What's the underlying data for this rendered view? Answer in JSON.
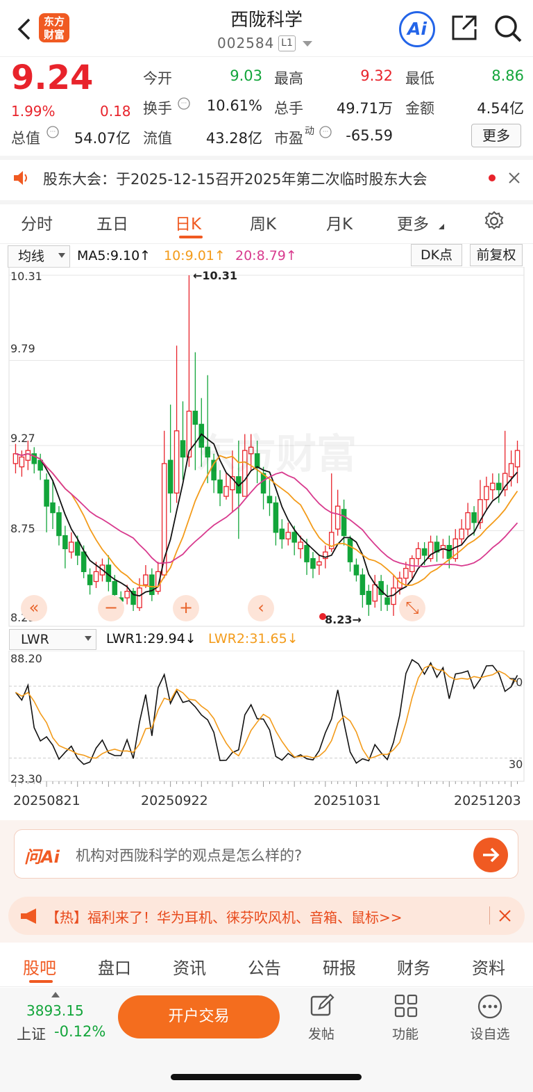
{
  "header": {
    "logo_text": "东方财富",
    "title": "西陇科学",
    "code": "002584",
    "level": "L1",
    "ai_label": "Ai"
  },
  "quote": {
    "price": "9.24",
    "change_pct": "1.99%",
    "change": "0.18",
    "open_label": "今开",
    "open": "9.03",
    "high_label": "最高",
    "high": "9.32",
    "low_label": "最低",
    "low": "8.86",
    "turnover_label": "换手",
    "turnover": "10.61%",
    "volume_label": "总手",
    "volume": "49.71万",
    "amount_label": "金额",
    "amount": "4.54亿",
    "mktcap_label": "总值",
    "mktcap": "54.07亿",
    "float_label": "流值",
    "float": "43.28亿",
    "pe_label": "市盈",
    "pe_sup": "动",
    "pe": "-65.59",
    "more_label": "更多"
  },
  "notice": {
    "text": "股东大会：于2025-12-15召开2025年第二次临时股东大会"
  },
  "tabs": [
    "分时",
    "五日",
    "日K",
    "周K",
    "月K",
    "更多"
  ],
  "active_tab": "日K",
  "chart_toolbar": {
    "indicator": "均线",
    "ma5": "MA5:9.10↑",
    "ma10": "10:9.01↑",
    "ma20": "20:8.79↑",
    "dk": "DK点",
    "adjust": "前复权"
  },
  "colors": {
    "up": "#e8232b",
    "down": "#12a53a",
    "ma5": "#111111",
    "ma10": "#f39b1a",
    "ma20": "#d83a8e",
    "accent": "#f05a22"
  },
  "chart_data": [
    {
      "type": "candlestick",
      "y_ticks": [
        "10.31",
        "9.79",
        "9.27",
        "8.75",
        "8.23"
      ],
      "ylim": [
        8.23,
        10.31
      ],
      "max_annotation": "←10.31",
      "min_annotation": "8.23→",
      "watermark": "东方财富",
      "candles": [
        [
          9.16,
          9.22,
          9.1,
          9.28
        ],
        [
          9.14,
          9.2,
          9.08,
          9.24
        ],
        [
          9.18,
          9.24,
          9.12,
          9.3
        ],
        [
          9.22,
          9.16,
          9.1,
          9.26
        ],
        [
          9.18,
          9.12,
          9.06,
          9.22
        ],
        [
          9.06,
          8.9,
          8.74,
          9.1
        ],
        [
          8.92,
          8.86,
          8.76,
          9.06
        ],
        [
          8.86,
          8.72,
          8.66,
          8.9
        ],
        [
          8.72,
          8.64,
          8.52,
          8.78
        ],
        [
          8.62,
          8.68,
          8.58,
          8.74
        ],
        [
          8.68,
          8.6,
          8.54,
          8.72
        ],
        [
          8.62,
          8.5,
          8.46,
          8.66
        ],
        [
          8.48,
          8.42,
          8.36,
          8.52
        ],
        [
          8.44,
          8.5,
          8.4,
          8.56
        ],
        [
          8.48,
          8.54,
          8.44,
          8.58
        ],
        [
          8.54,
          8.44,
          8.38,
          8.6
        ],
        [
          8.44,
          8.36,
          8.3,
          8.48
        ],
        [
          8.34,
          8.32,
          8.26,
          8.38
        ],
        [
          8.34,
          8.38,
          8.3,
          8.42
        ],
        [
          8.38,
          8.3,
          8.26,
          8.4
        ],
        [
          8.28,
          8.4,
          8.26,
          8.46
        ],
        [
          8.42,
          8.48,
          8.4,
          8.54
        ],
        [
          8.48,
          8.36,
          8.32,
          8.52
        ],
        [
          8.38,
          8.5,
          8.36,
          8.56
        ],
        [
          8.48,
          9.16,
          8.46,
          9.36
        ],
        [
          9.18,
          8.98,
          8.86,
          9.52
        ],
        [
          8.98,
          9.36,
          8.92,
          9.88
        ],
        [
          9.3,
          9.2,
          9.06,
          9.54
        ],
        [
          9.2,
          9.48,
          9.14,
          10.31
        ],
        [
          9.48,
          9.4,
          9.12,
          9.84
        ],
        [
          9.4,
          9.26,
          9.14,
          9.56
        ],
        [
          9.26,
          9.2,
          9.04,
          9.7
        ],
        [
          9.18,
          9.06,
          8.98,
          9.22
        ],
        [
          9.06,
          8.98,
          8.9,
          9.12
        ],
        [
          8.96,
          9.02,
          8.94,
          9.1
        ],
        [
          9.0,
          9.08,
          8.86,
          9.24
        ],
        [
          9.08,
          8.98,
          8.7,
          9.3
        ],
        [
          8.96,
          9.24,
          8.96,
          9.34
        ],
        [
          9.22,
          9.26,
          9.12,
          9.34
        ],
        [
          9.22,
          9.14,
          9.04,
          9.3
        ],
        [
          9.1,
          8.98,
          8.88,
          9.14
        ],
        [
          8.96,
          8.92,
          8.84,
          9.06
        ],
        [
          8.92,
          8.74,
          8.66,
          8.96
        ],
        [
          8.76,
          8.7,
          8.64,
          8.82
        ],
        [
          8.7,
          8.74,
          8.66,
          8.8
        ],
        [
          8.74,
          8.68,
          8.6,
          8.78
        ],
        [
          8.64,
          8.68,
          8.58,
          8.72
        ],
        [
          8.66,
          8.56,
          8.48,
          8.7
        ],
        [
          8.58,
          8.52,
          8.46,
          8.62
        ],
        [
          8.54,
          8.56,
          8.48,
          8.6
        ],
        [
          8.58,
          8.62,
          8.52,
          8.66
        ],
        [
          8.64,
          8.74,
          8.62,
          9.1
        ],
        [
          8.76,
          8.9,
          8.72,
          9.0
        ],
        [
          8.88,
          8.72,
          8.66,
          8.94
        ],
        [
          8.7,
          8.56,
          8.5,
          8.72
        ],
        [
          8.54,
          8.48,
          8.44,
          8.58
        ],
        [
          8.48,
          8.36,
          8.28,
          8.52
        ],
        [
          8.38,
          8.3,
          8.23,
          8.42
        ],
        [
          8.32,
          8.42,
          8.28,
          8.48
        ],
        [
          8.44,
          8.36,
          8.26,
          8.48
        ],
        [
          8.34,
          8.3,
          8.26,
          8.42
        ],
        [
          8.3,
          8.4,
          8.23,
          8.48
        ],
        [
          8.4,
          8.46,
          8.36,
          8.5
        ],
        [
          8.46,
          8.52,
          8.42,
          8.56
        ],
        [
          8.5,
          8.58,
          8.46,
          8.6
        ],
        [
          8.58,
          8.64,
          8.54,
          8.68
        ],
        [
          8.64,
          8.6,
          8.54,
          8.68
        ],
        [
          8.58,
          8.68,
          8.56,
          8.72
        ],
        [
          8.68,
          8.62,
          8.56,
          8.72
        ],
        [
          8.64,
          8.66,
          8.58,
          8.7
        ],
        [
          8.66,
          8.58,
          8.52,
          8.72
        ],
        [
          8.58,
          8.7,
          8.56,
          8.76
        ],
        [
          8.7,
          8.76,
          8.66,
          8.82
        ],
        [
          8.76,
          8.86,
          8.72,
          8.92
        ],
        [
          8.86,
          8.8,
          8.72,
          8.9
        ],
        [
          8.8,
          8.94,
          8.76,
          9.06
        ],
        [
          8.94,
          9.02,
          8.88,
          9.08
        ],
        [
          9.0,
          9.04,
          8.94,
          9.1
        ],
        [
          9.04,
          9.0,
          8.92,
          9.1
        ],
        [
          9.0,
          9.1,
          8.96,
          9.36
        ],
        [
          9.08,
          9.16,
          9.02,
          9.24
        ],
        [
          9.14,
          9.24,
          9.04,
          9.3
        ]
      ]
    },
    {
      "type": "line",
      "indicator": "LWR",
      "series": [
        {
          "name": "LWR1",
          "value_label": "LWR1:29.94↓"
        },
        {
          "name": "LWR2",
          "value_label": "LWR2:31.65↓"
        }
      ],
      "y_ticks": [
        "88.20",
        "23.30"
      ],
      "ref_levels": [
        "70",
        "30"
      ],
      "x_ticks": [
        "20250821",
        "20250922",
        "20251031",
        "20251203"
      ]
    }
  ],
  "chart_controls": [
    "«",
    "−",
    "+",
    "‹",
    "⤡"
  ],
  "ask_ai": {
    "brand": "问Ai",
    "placeholder": "机构对西陇科学的观点是怎么样的?"
  },
  "promo": {
    "text": "【热】福利来了！华为耳机、徕芬吹风机、音箱、鼠标>>"
  },
  "bottom_tabs": [
    "股吧",
    "盘口",
    "资讯",
    "公告",
    "研报",
    "财务",
    "资料"
  ],
  "active_bottom_tab": "股吧",
  "footer": {
    "index_value": "3893.15",
    "index_name": "上证",
    "index_change": "-0.12%",
    "trade_button": "开户交易",
    "post_label": "发帖",
    "func_label": "功能",
    "watch_label": "设自选"
  }
}
